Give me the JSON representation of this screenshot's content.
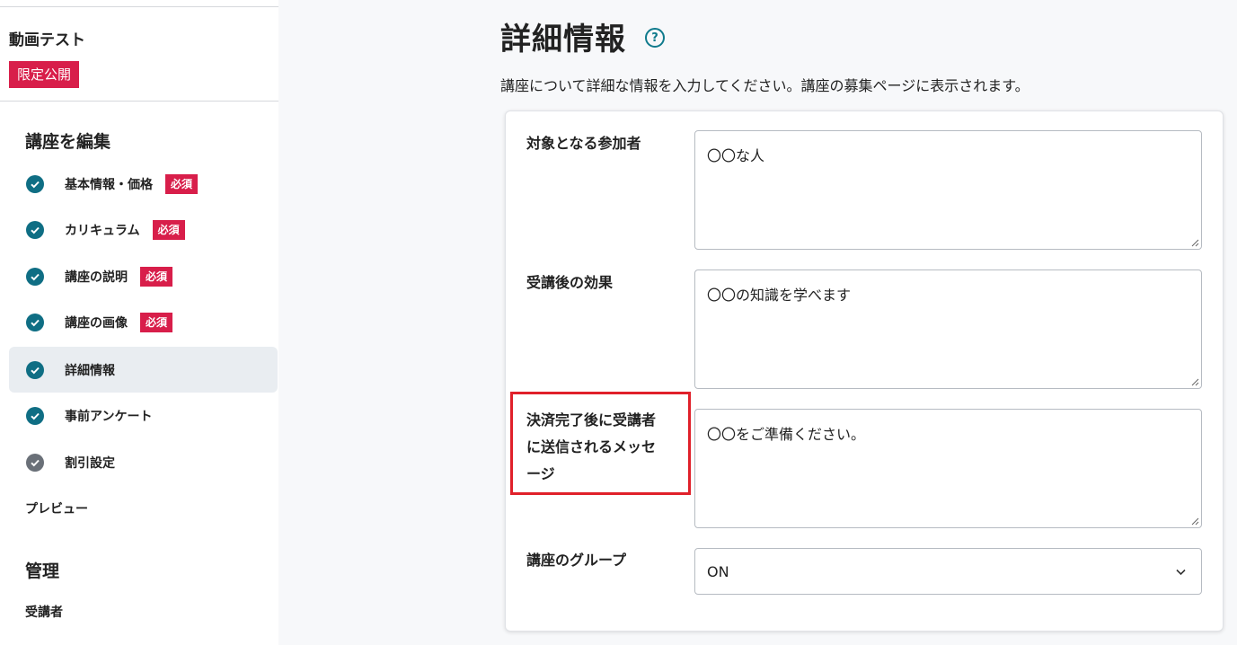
{
  "sidebar": {
    "course_title": "動画テスト",
    "status_badge": "限定公開",
    "edit_heading": "講座を編集",
    "items": [
      {
        "label": "基本情報・価格",
        "required": "必須"
      },
      {
        "label": "カリキュラム",
        "required": "必須"
      },
      {
        "label": "講座の説明",
        "required": "必須"
      },
      {
        "label": "講座の画像",
        "required": "必須"
      },
      {
        "label": "詳細情報"
      },
      {
        "label": "事前アンケート"
      },
      {
        "label": "割引設定"
      }
    ],
    "preview_label": "プレビュー",
    "manage_heading": "管理",
    "students_label": "受講者"
  },
  "main": {
    "title": "詳細情報",
    "help_icon": "?",
    "description": "講座について詳細な情報を入力してください。講座の募集ページに表示されます。",
    "fields": {
      "audience": {
        "label": "対象となる参加者",
        "value": "〇〇な人"
      },
      "effect": {
        "label": "受講後の効果",
        "value": "〇〇の知識を学べます"
      },
      "message": {
        "label_line1": "決済完了後に受講者",
        "label_line2": "に送信されるメッセ",
        "label_line3": "ージ",
        "value": "〇〇をご準備ください。"
      },
      "group": {
        "label": "講座のグループ",
        "value": "ON"
      }
    }
  },
  "colors": {
    "accent": "#0f6e84",
    "badge": "#d81e4a",
    "highlight": "#e0202a",
    "active_bg": "#e9edf1",
    "pending_check": "#6a7078"
  },
  "icons": [
    "check-circle-icon",
    "help-icon",
    "resize-handle-icon",
    "chevron-down-icon"
  ]
}
